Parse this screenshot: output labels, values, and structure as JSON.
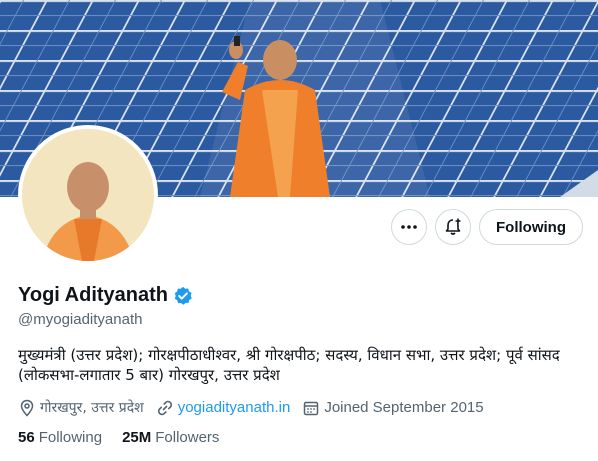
{
  "profile": {
    "name": "Yogi Adityanath",
    "handle": "@myogiadityanath",
    "bio": "मुख्यमंत्री (उत्तर प्रदेश); गोरक्षपीठाधीश्वर, श्री गोरक्षपीठ; सदस्य, विधान सभा, उत्तर प्रदेश; पूर्व सांसद (लोकसभा-लगातार 5 बार) गोरखपुर, उत्तर प्रदेश",
    "location": "गोरखपुर, उत्तर प्रदेश",
    "website": "yogiadityanath.in",
    "joined": "Joined September 2015",
    "following_count": "56",
    "following_label": "Following",
    "followers_count": "25M",
    "followers_label": "Followers",
    "verified": true
  },
  "actions": {
    "more_icon": "more-dots-icon",
    "notify_icon": "bell-plus-icon",
    "follow_label": "Following"
  },
  "colors": {
    "accent": "#1d9bf0",
    "text": "#0f1419",
    "muted": "#536471",
    "border": "#cfd9de"
  }
}
